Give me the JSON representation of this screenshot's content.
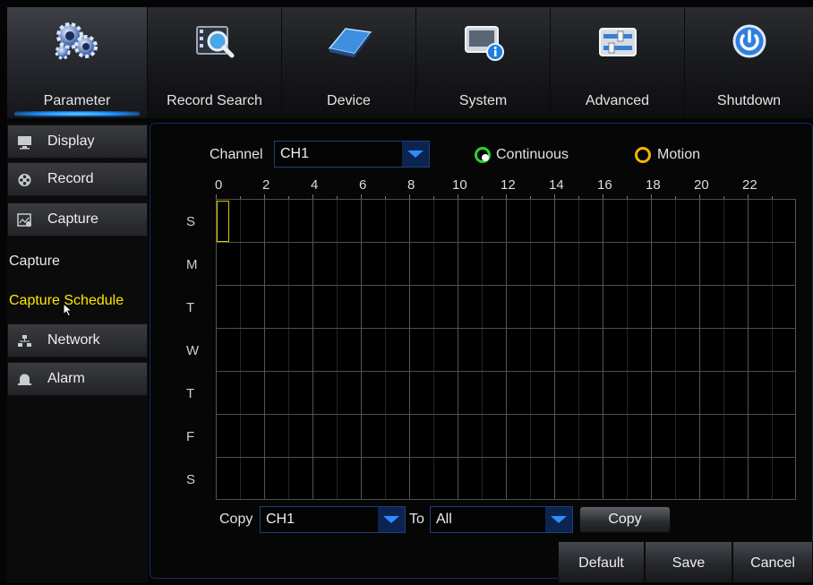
{
  "nav": {
    "tabs": [
      {
        "label": "Parameter",
        "icon": "gears-icon",
        "active": true
      },
      {
        "label": "Record Search",
        "icon": "film-search-icon",
        "active": false
      },
      {
        "label": "Device",
        "icon": "hard-disk-icon",
        "active": false
      },
      {
        "label": "System",
        "icon": "system-info-icon",
        "active": false
      },
      {
        "label": "Advanced",
        "icon": "sliders-icon",
        "active": false
      },
      {
        "label": "Shutdown",
        "icon": "power-icon",
        "active": false
      }
    ]
  },
  "sidebar": {
    "items": [
      {
        "label": "Display",
        "icon": "monitor-icon"
      },
      {
        "label": "Record",
        "icon": "film-reel-icon"
      },
      {
        "label": "Capture",
        "icon": "capture-icon"
      },
      {
        "label": "Capture"
      },
      {
        "label": "Capture Schedule",
        "selected": true
      },
      {
        "label": "Network",
        "icon": "network-icon"
      },
      {
        "label": "Alarm",
        "icon": "alarm-bell-icon"
      }
    ]
  },
  "schedule": {
    "channel_label": "Channel",
    "channel_value": "CH1",
    "legend": {
      "continuous": {
        "label": "Continuous",
        "color": "#2bd42b"
      },
      "motion": {
        "label": "Motion",
        "color": "#f2b400"
      }
    },
    "hours": [
      "0",
      "2",
      "4",
      "6",
      "8",
      "10",
      "12",
      "14",
      "16",
      "18",
      "20",
      "22"
    ],
    "days": [
      "S",
      "M",
      "T",
      "W",
      "T",
      "F",
      "S"
    ],
    "copy_label": "Copy",
    "copy_from_value": "CH1",
    "to_label": "To",
    "copy_to_value": "All",
    "copy_button": "Copy"
  },
  "footer": {
    "default_label": "Default",
    "save_label": "Save",
    "cancel_label": "Cancel"
  },
  "colors": {
    "accent_blue": "#1c8fff",
    "selection_yellow": "#ffe600"
  }
}
